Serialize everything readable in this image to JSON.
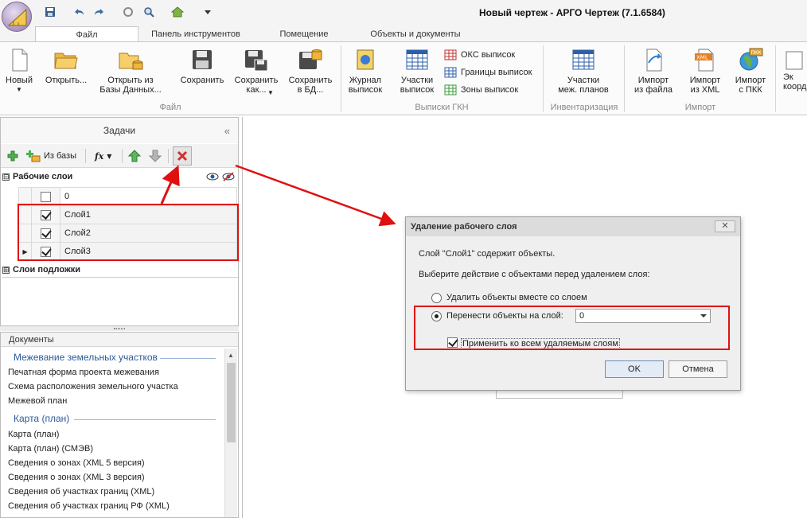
{
  "window": {
    "title": "Новый чертеж - АРГО Чертеж (7.1.6584)"
  },
  "ribbon_tabs": [
    {
      "label": "Файл",
      "active": true
    },
    {
      "label": "Панель инструментов",
      "active": false
    },
    {
      "label": "Помещение",
      "active": false
    },
    {
      "label": "Объекты и документы",
      "active": false
    }
  ],
  "ribbon": {
    "file_group": {
      "label": "Файл",
      "new": "Новый",
      "open": "Открыть...",
      "open_db": "Открыть из\nБазы Данных...",
      "save": "Сохранить",
      "save_as": "Сохранить\nкак...",
      "save_db": "Сохранить\nв БД..."
    },
    "gkn_group": {
      "label": "Выписки ГКН",
      "journal": "Журнал\nвыписок",
      "parcels": "Участки\nвыписок",
      "oks": "ОКС выписок",
      "bounds": "Границы выписок",
      "zones": "Зоны выписок"
    },
    "inv_group": {
      "label": "Инвентаризация",
      "parcels": "Участки\nмеж. планов"
    },
    "import_group": {
      "label": "Импорт",
      "from_file": "Импорт\nиз файла",
      "from_xml": "Импорт\nиз XML",
      "from_pkk": "Импорт\nс ПКК",
      "pkk_badge": "ПКК",
      "xml_badge": "XML"
    },
    "extra": "Эк\nкоорд"
  },
  "tasks": {
    "title": "Задачи",
    "collapse": "«",
    "toolbar": {
      "from_db": "Из базы",
      "fx": "fx"
    },
    "working_layers": {
      "label": "Рабочие слои",
      "expander": "⊟",
      "rows": [
        {
          "name": "0",
          "checked": false,
          "current": false
        },
        {
          "name": "Слой1",
          "checked": true,
          "current": false
        },
        {
          "name": "Слой2",
          "checked": true,
          "current": false
        },
        {
          "name": "Слой3",
          "checked": true,
          "current": true
        }
      ]
    },
    "base_layers": {
      "label": "Слои подложки",
      "expander": "⊞"
    }
  },
  "documents": {
    "title": "Документы",
    "groups": [
      {
        "label": "Межевание земельных участков",
        "items": [
          "Печатная форма проекта межевания",
          "Схема расположения земельного участка",
          "Межевой план"
        ]
      },
      {
        "label": "Карта (план)",
        "items": [
          "Карта (план)",
          "Карта (план) (СМЭВ)",
          "Сведения о зонах (XML 5 версия)",
          "Сведения о зонах (XML 3 версия)",
          "Сведения об участках границ (XML)",
          "Сведения об участках границ РФ (XML)"
        ]
      }
    ]
  },
  "dialog": {
    "title": "Удаление рабочего слоя",
    "close": "✕",
    "message": "Слой \"Слой1\" содержит объекты.",
    "prompt": "Выберите действие с объектами перед удалением слоя:",
    "option_delete": "Удалить объекты вместе со слоем",
    "option_move": "Перенести объекты на слой:",
    "target_layer": "0",
    "apply_all": "Применить ко всем удаляемым слоям",
    "ok": "OK",
    "cancel": "Отмена"
  },
  "colors": {
    "annotation": "#e01010",
    "accent": "#2a5a9a"
  }
}
